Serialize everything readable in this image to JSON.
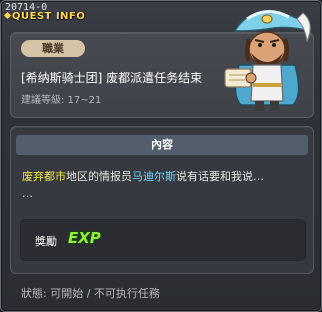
{
  "window": {
    "quest_id": "20714-0",
    "title": "QUEST INFO"
  },
  "header": {
    "job_tag": "職業",
    "quest_name": "[希纳斯骑士团] 废都派遣任务结束",
    "level_text": "建議等級: 17~21"
  },
  "content": {
    "section_title": "內容",
    "description": {
      "place": "废弃都市",
      "part1": "地区的情报员",
      "npc": "马迪尔斯",
      "part2": "说有话要和我说…",
      "line2": "…"
    },
    "reward": {
      "label": "獎勵",
      "exp_text": "EXP"
    }
  },
  "status": {
    "text": "狀態: 可開始 / 不可执行任務"
  },
  "colors": {
    "title": "#ffd84a",
    "place_highlight": "#f2e74a",
    "npc_highlight": "#6fdcff",
    "exp": "#8ff03a"
  }
}
